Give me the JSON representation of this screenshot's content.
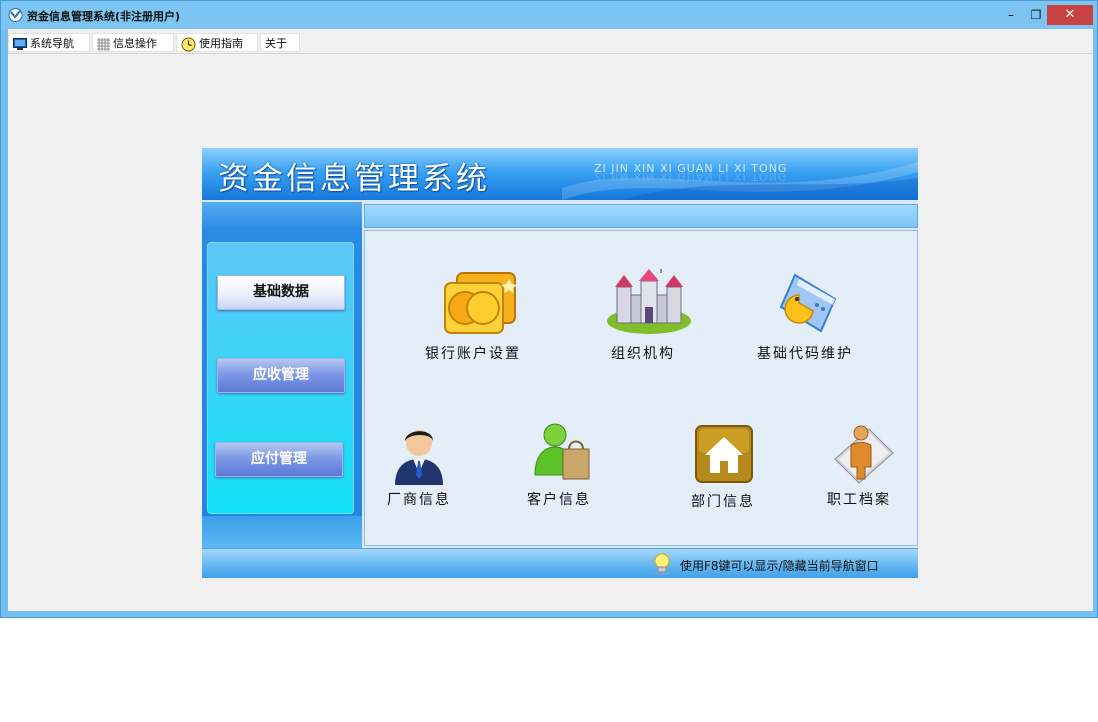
{
  "window": {
    "title": "资金信息管理系统(非注册用户)",
    "controls": {
      "minimize": "–",
      "restore": "❐",
      "close": "✕"
    }
  },
  "menu": [
    {
      "label": "系统导航",
      "icon": "monitor-icon"
    },
    {
      "label": "信息操作",
      "icon": "grid-icon"
    },
    {
      "label": "使用指南",
      "icon": "clock-icon"
    },
    {
      "label": "关于",
      "icon": ""
    }
  ],
  "banner": {
    "title": "资金信息管理系统",
    "pinyin": "ZI JIN XIN XI GUAN LI XI TONG"
  },
  "sidebar": {
    "buttons": [
      {
        "label": "基础数据",
        "active": true
      },
      {
        "label": "应收管理",
        "active": false
      },
      {
        "label": "应付管理",
        "active": false
      }
    ]
  },
  "tiles": [
    {
      "label": "银行账户设置",
      "icon": "gold-coins-icon"
    },
    {
      "label": "组织机构",
      "icon": "castle-icon"
    },
    {
      "label": "基础代码维护",
      "icon": "pacman-book-icon"
    },
    {
      "label": "厂商信息",
      "icon": "businessman-icon"
    },
    {
      "label": "客户信息",
      "icon": "customer-bag-icon"
    },
    {
      "label": "部门信息",
      "icon": "house-icon"
    },
    {
      "label": "职工档案",
      "icon": "employee-file-icon"
    }
  ],
  "status": {
    "hint": "使用F8键可以显示/隐藏当前导航窗口"
  },
  "colors": {
    "titlebar": "#7cc4f2",
    "close": "#c94242",
    "banner": "#1477db",
    "sidebar": "#12e3f6"
  }
}
